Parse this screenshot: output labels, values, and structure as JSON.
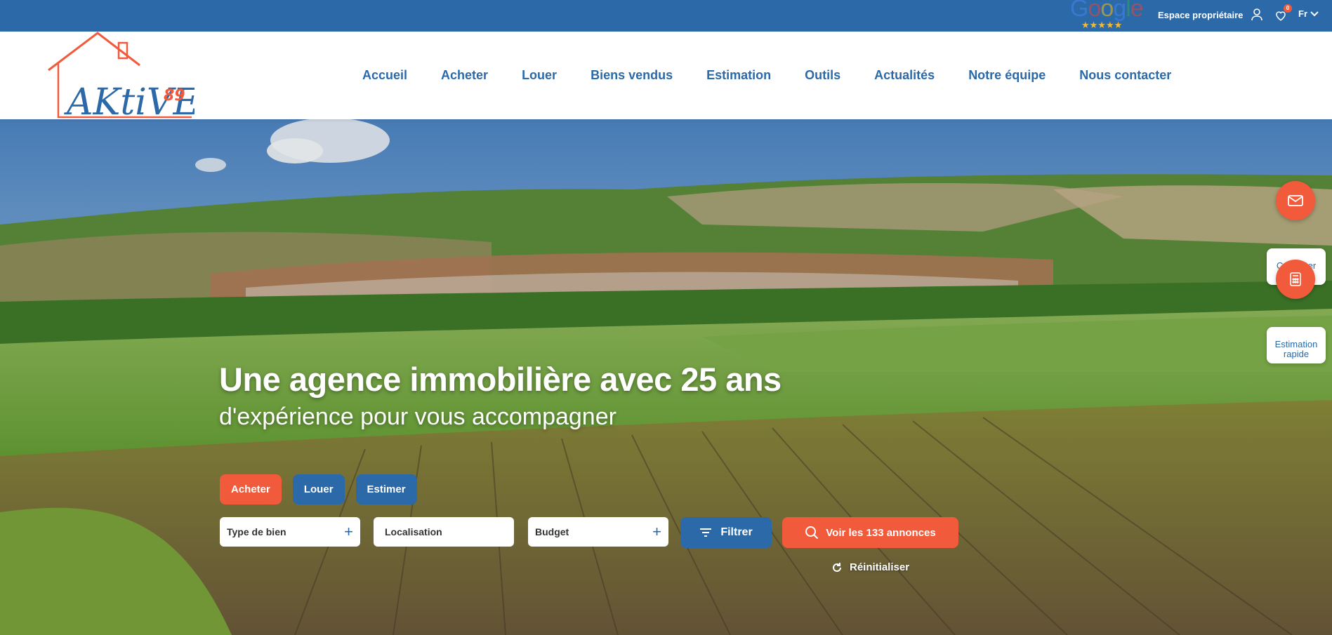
{
  "topbar": {
    "google_word": [
      "G",
      "o",
      "o",
      "g",
      "l",
      "e"
    ],
    "google_stars": "★★★★★",
    "owner_label": "Espace propriétaire",
    "favorites_count": "0",
    "lang": "Fr"
  },
  "logo": {
    "text": "AKtiVE",
    "number": "89"
  },
  "nav": {
    "items": [
      "Accueil",
      "Acheter",
      "Louer",
      "Biens vendus",
      "Estimation",
      "Outils",
      "Actualités",
      "Notre équipe",
      "Nous contacter"
    ]
  },
  "hero": {
    "headline": "Une agence immobilière avec 25 ans",
    "subline": "d'expérience pour vous accompagner"
  },
  "search": {
    "tabs": [
      "Acheter",
      "Louer",
      "Estimer"
    ],
    "type_label": "Type de bien",
    "location_label": "Localisation",
    "budget_label": "Budget",
    "filter_label": "Filtrer",
    "see_label": "Voir les 133 annonces",
    "reset_label": "Réinitialiser"
  },
  "side": {
    "contact_line1": "Contacter",
    "contact_line2": "l'agence",
    "estimate_line1": "Estimation",
    "estimate_line2": "rapide"
  },
  "colors": {
    "brand_blue": "#2b69a8",
    "accent_orange": "#f15a3a"
  }
}
